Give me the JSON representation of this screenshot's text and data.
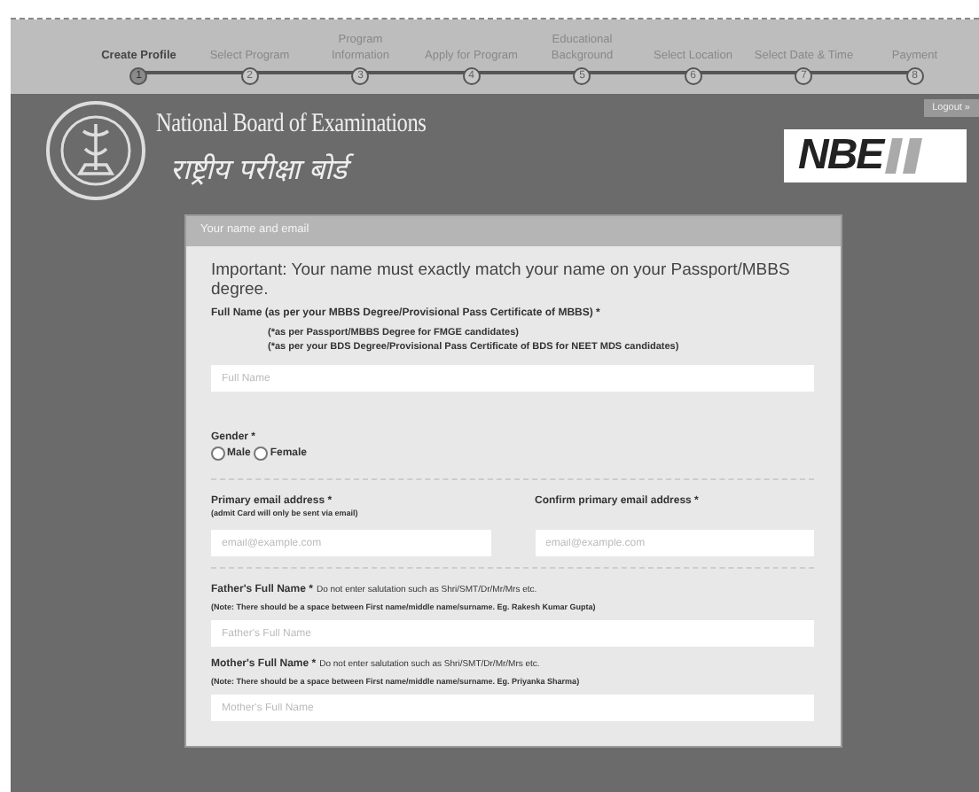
{
  "steps": [
    {
      "number": "1",
      "label": "Create Profile",
      "selected": true
    },
    {
      "number": "2",
      "label": "Select Program",
      "selected": false
    },
    {
      "number": "3",
      "label": "Program Information",
      "selected": false
    },
    {
      "number": "4",
      "label": "Apply for Program",
      "selected": false
    },
    {
      "number": "5",
      "label": "Educational Background",
      "selected": false
    },
    {
      "number": "6",
      "label": "Select Location",
      "selected": false
    },
    {
      "number": "7",
      "label": "Select Date & Time",
      "selected": false
    },
    {
      "number": "8",
      "label": "Payment",
      "selected": false
    }
  ],
  "header": {
    "title": "National Board of Examinations",
    "hindi_title": "राष्ट्रीय परीक्षा बोर्ड",
    "logo_text": "NBE",
    "logout": "Logout »"
  },
  "form": {
    "title": "Your name and email",
    "notice": "Important: Your name must exactly match your name on your Passport/MBBS degree.",
    "full_name": {
      "label": "Full Name (as per your MBBS Degree/Provisional Pass Certificate of MBBS) *",
      "notes": [
        "(*as per Passport/MBBS Degree for FMGE candidates)",
        "(*as per your BDS Degree/Provisional Pass Certificate of BDS for NEET MDS candidates)"
      ],
      "placeholder": "Full Name"
    },
    "gender": {
      "label": "Gender *",
      "options": [
        {
          "label": "Male",
          "selected": false
        },
        {
          "label": "Female",
          "selected": false
        }
      ]
    },
    "emails": [
      {
        "label": "Primary email address *",
        "note": "(admit Card will only be sent via email)",
        "placeholder": "email@example.com"
      },
      {
        "label": "Confirm primary email address *",
        "placeholder": "email@example.com"
      }
    ],
    "parents": [
      {
        "label": "Father's Full Name *",
        "hint": "Do not enter salutation such as Shri/SMT/Dr/Mr/Mrs etc.",
        "note": "(Note: There should be a space between First name/middle name/surname. Eg. Rakesh Kumar Gupta)",
        "placeholder": "Father's Full Name"
      },
      {
        "label": "Mother's Full Name *",
        "hint": "Do not enter salutation such as Shri/SMT/Dr/Mr/Mrs etc.",
        "note": "(Note: There should be a space between First name/middle name/surname. Eg. Priyanka Sharma)",
        "placeholder": "Mother's Full Name"
      }
    ]
  }
}
